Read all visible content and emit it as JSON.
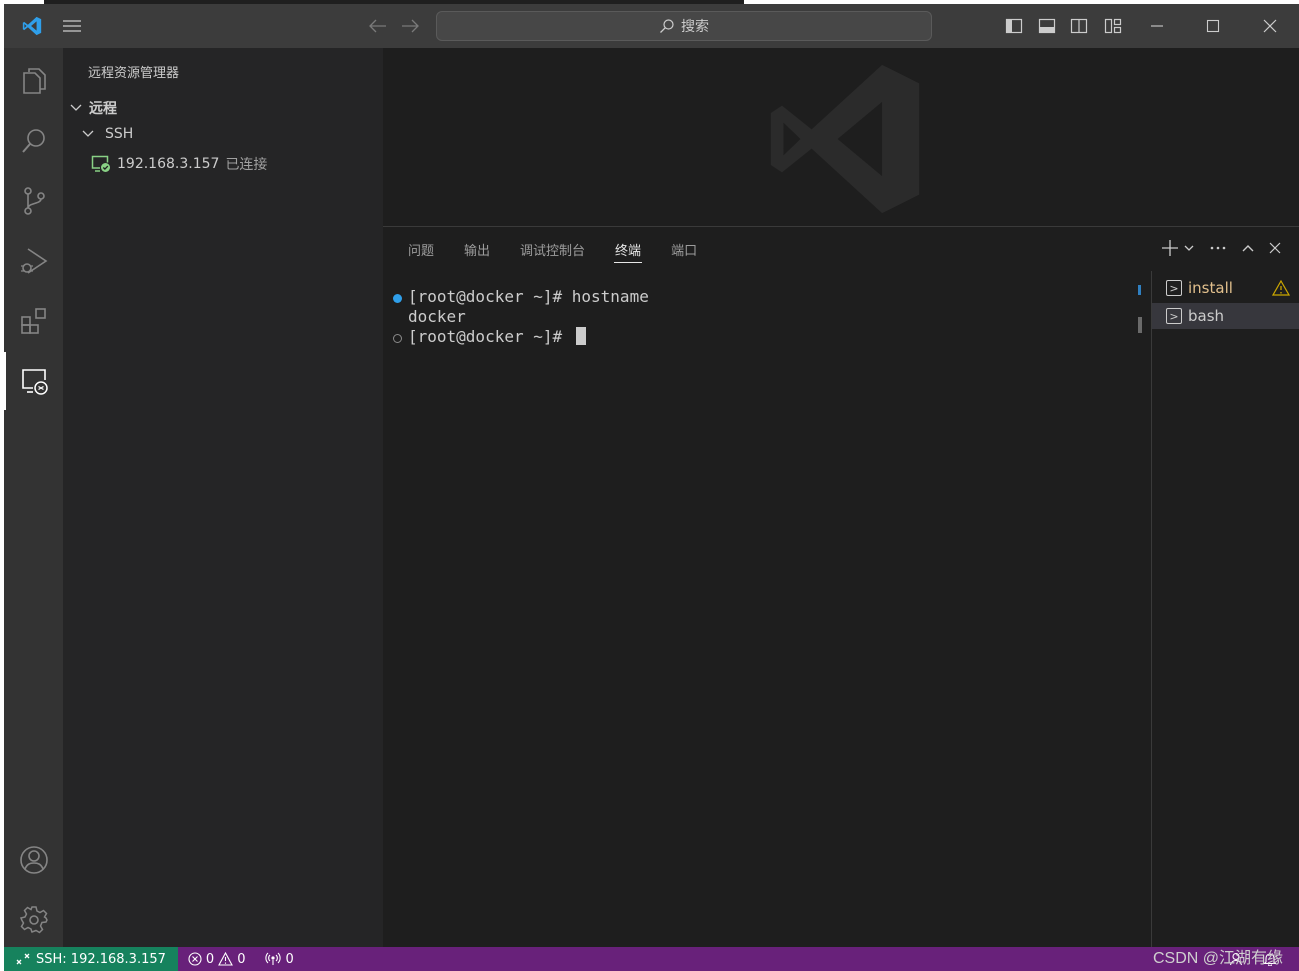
{
  "titlebar": {
    "search_placeholder": "搜索",
    "icons": [
      "vscode-logo-icon",
      "menu-icon",
      "back-arrow-icon",
      "forward-arrow-icon",
      "toggle-primary-sidebar-icon",
      "toggle-panel-icon",
      "toggle-secondary-sidebar-icon",
      "customize-layout-icon",
      "minimize-icon",
      "maximize-icon",
      "close-icon"
    ]
  },
  "activitybar": {
    "items": [
      "explorer-icon",
      "search-icon",
      "source-control-icon",
      "run-debug-icon",
      "extensions-icon",
      "remote-explorer-icon"
    ],
    "bottom": [
      "accounts-icon",
      "settings-gear-icon"
    ]
  },
  "sidebar": {
    "title": "远程资源管理器",
    "section": "远程",
    "group": "SSH",
    "host": "192.168.3.157",
    "host_status": "已连接"
  },
  "panel": {
    "tabs": [
      "问题",
      "输出",
      "调试控制台",
      "终端",
      "端口"
    ],
    "active_tab": "终端"
  },
  "terminal": {
    "line1_prompt": "[root@docker ~]# ",
    "line1_command": "hostname",
    "line2_output": "docker",
    "line3_prompt": "[root@docker ~]# "
  },
  "terminal_list": {
    "items": [
      {
        "label": "install",
        "color": "#e2c08d",
        "warning": true
      },
      {
        "label": "bash",
        "color": "#cccccc",
        "warning": false
      }
    ]
  },
  "statusbar": {
    "remote_label": "SSH: 192.168.3.157",
    "errors": "0",
    "warnings": "0",
    "ports": "0"
  },
  "watermark": "CSDN @江湖有缘",
  "colors": {
    "accent": "#0078d4",
    "statusbar": "#68217a",
    "remote": "#16825d",
    "connected": "#89d185"
  }
}
